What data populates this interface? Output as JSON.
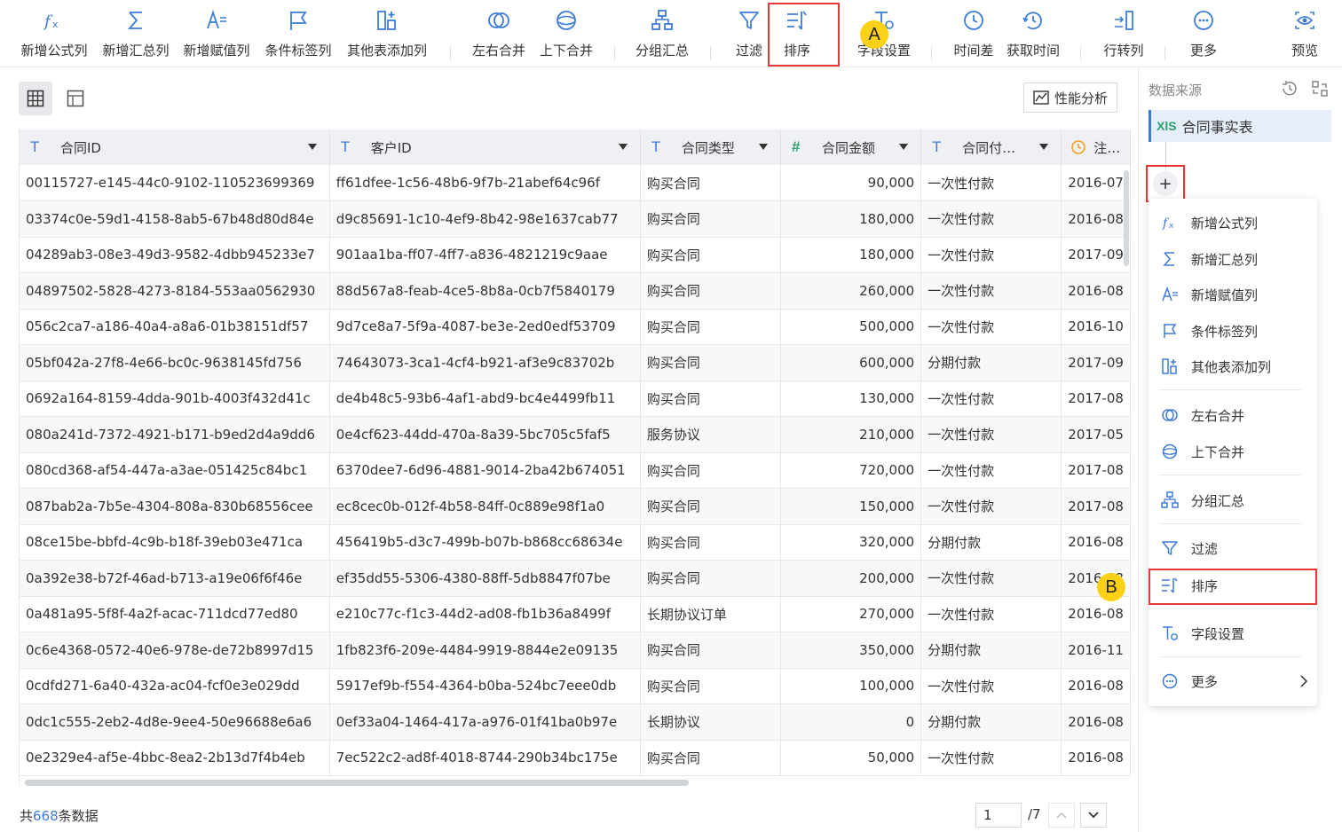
{
  "toolbar": {
    "items": [
      {
        "label": "新增公式列",
        "icon": "fx-icon"
      },
      {
        "label": "新增汇总列",
        "icon": "sigma-icon"
      },
      {
        "label": "新增赋值列",
        "icon": "assign-icon"
      },
      {
        "label": "条件标签列",
        "icon": "flag-icon"
      },
      {
        "label": "其他表添加列",
        "icon": "add-column-icon"
      },
      {
        "label": "左右合并",
        "icon": "merge-horizontal-icon"
      },
      {
        "label": "上下合并",
        "icon": "merge-vertical-icon"
      },
      {
        "label": "分组汇总",
        "icon": "group-icon"
      },
      {
        "label": "过滤",
        "icon": "filter-icon"
      },
      {
        "label": "排序",
        "icon": "sort-icon"
      },
      {
        "label": "字段设置",
        "icon": "field-settings-icon"
      },
      {
        "label": "时间差",
        "icon": "clock-icon"
      },
      {
        "label": "获取时间",
        "icon": "clock-refresh-icon"
      },
      {
        "label": "行转列",
        "icon": "row-to-column-icon"
      },
      {
        "label": "更多",
        "icon": "more-icon"
      },
      {
        "label": "预览",
        "icon": "eye-icon"
      }
    ],
    "badge_a": "A"
  },
  "main": {
    "perf_button": "性能分析"
  },
  "table": {
    "columns": [
      {
        "name": "合同ID",
        "type": "T"
      },
      {
        "name": "客户ID",
        "type": "T"
      },
      {
        "name": "合同类型",
        "type": "T"
      },
      {
        "name": "合同金额",
        "type": "#"
      },
      {
        "name": "合同付…",
        "type": "T"
      },
      {
        "name": "注…",
        "type": "date"
      }
    ],
    "rows": [
      [
        "00115727-e145-44c0-9102-110523699369",
        "ff61dfee-1c56-48b6-9f7b-21abef64c96f",
        "购买合同",
        "90,000",
        "一次性付款",
        "2016-07"
      ],
      [
        "03374c0e-59d1-4158-8ab5-67b48d80d84e",
        "d9c85691-1c10-4ef9-8b42-98e1637cab77",
        "购买合同",
        "180,000",
        "一次性付款",
        "2016-08"
      ],
      [
        "04289ab3-08e3-49d3-9582-4dbb945233e7",
        "901aa1ba-ff07-4ff7-a836-4821219c9aae",
        "购买合同",
        "180,000",
        "一次性付款",
        "2017-09"
      ],
      [
        "04897502-5828-4273-8184-553aa0562930",
        "88d567a8-feab-4ce5-8b8a-0cb7f5840179",
        "购买合同",
        "260,000",
        "一次性付款",
        "2016-08"
      ],
      [
        "056c2ca7-a186-40a4-a8a6-01b38151df57",
        "9d7ce8a7-5f9a-4087-be3e-2ed0edf53709",
        "购买合同",
        "500,000",
        "一次性付款",
        "2016-10"
      ],
      [
        "05bf042a-27f8-4e66-bc0c-9638145fd756",
        "74643073-3ca1-4cf4-b921-af3e9c83702b",
        "购买合同",
        "600,000",
        "分期付款",
        "2017-09"
      ],
      [
        "0692a164-8159-4dda-901b-4003f432d41c",
        "de4b48c5-93b6-4af1-abd9-bc4e4499fb11",
        "购买合同",
        "130,000",
        "一次性付款",
        "2017-08"
      ],
      [
        "080a241d-7372-4921-b171-b9ed2d4a9dd6",
        "0e4cf623-44dd-470a-8a39-5bc705c5faf5",
        "服务协议",
        "210,000",
        "一次性付款",
        "2017-05"
      ],
      [
        "080cd368-af54-447a-a3ae-051425c84bc1",
        "6370dee7-6d96-4881-9014-2ba42b674051",
        "购买合同",
        "720,000",
        "一次性付款",
        "2017-08"
      ],
      [
        "087bab2a-7b5e-4304-808a-830b68556cee",
        "ec8cec0b-012f-4b58-84ff-0c889e98f1a0",
        "购买合同",
        "150,000",
        "一次性付款",
        "2017-08"
      ],
      [
        "08ce15be-bbfd-4c9b-b18f-39eb03e471ca",
        "456419b5-d3c7-499b-b07b-b868cc68634e",
        "购买合同",
        "320,000",
        "分期付款",
        "2016-08"
      ],
      [
        "0a392e38-b72f-46ad-b713-a19e06f6f46e",
        "ef35dd55-5306-4380-88ff-5db8847f07be",
        "购买合同",
        "200,000",
        "一次性付款",
        "2016-08"
      ],
      [
        "0a481a95-5f8f-4a2f-acac-711dcd77ed80",
        "e210c77c-f1c3-44d2-ad08-fb1b36a8499f",
        "长期协议订单",
        "270,000",
        "一次性付款",
        "2016-08"
      ],
      [
        "0c6e4368-0572-40e6-978e-de72b8997d15",
        "1fb823f6-209e-4484-9919-8844e2e09135",
        "购买合同",
        "350,000",
        "分期付款",
        "2016-11"
      ],
      [
        "0cdfd271-6a40-432a-ac04-fcf0e3e029dd",
        "5917ef9b-f554-4364-b0ba-524bc7eee0db",
        "购买合同",
        "100,000",
        "一次性付款",
        "2016-08"
      ],
      [
        "0dc1c555-2eb2-4d8e-9ee4-50e96688e6a6",
        "0ef33a04-1464-417a-a976-01f41ba0b97e",
        "长期协议",
        "0",
        "分期付款",
        "2016-08"
      ],
      [
        "0e2329e4-af5e-4bbc-8ea2-2b13d7f4b4eb",
        "7ec522c2-ad8f-4018-8744-290b34bc175e",
        "购买合同",
        "50,000",
        "一次性付款",
        "2016-08"
      ]
    ]
  },
  "footer": {
    "count_prefix": "共",
    "count": "668",
    "count_suffix": "条数据",
    "page": "1",
    "total_pages": "/7"
  },
  "panel": {
    "title": "数据来源",
    "source_badge": "XlS",
    "source_name": "合同事实表",
    "plus": "+",
    "badge_b": "B",
    "menu": [
      {
        "label": "新增公式列",
        "icon": "fx-icon"
      },
      {
        "label": "新增汇总列",
        "icon": "sigma-icon"
      },
      {
        "label": "新增赋值列",
        "icon": "assign-icon"
      },
      {
        "label": "条件标签列",
        "icon": "flag-icon"
      },
      {
        "label": "其他表添加列",
        "icon": "add-column-icon"
      },
      {
        "label": "左右合并",
        "icon": "merge-horizontal-icon"
      },
      {
        "label": "上下合并",
        "icon": "merge-vertical-icon"
      },
      {
        "label": "分组汇总",
        "icon": "group-icon"
      },
      {
        "label": "过滤",
        "icon": "filter-icon"
      },
      {
        "label": "排序",
        "icon": "sort-icon"
      },
      {
        "label": "字段设置",
        "icon": "field-settings-icon"
      },
      {
        "label": "更多",
        "icon": "more-icon"
      }
    ]
  },
  "colors": {
    "accent": "#3d7bd9",
    "highlight": "#e53935",
    "badge": "#fcd116"
  }
}
